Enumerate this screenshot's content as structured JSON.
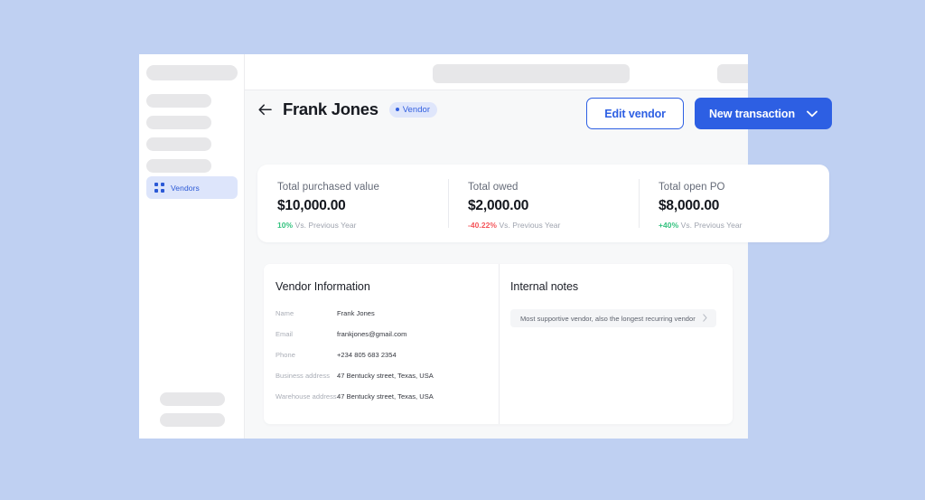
{
  "theme": {
    "background": "#bfd0f2",
    "app_surface": "#f7f8f9",
    "accent": "#2d5fe3",
    "positive": "#34c27f",
    "negative": "#f4555a"
  },
  "sidebar": {
    "active_item": {
      "label": "Vendors",
      "icon": "grid-icon"
    }
  },
  "topbar": {
    "search_placeholder": ""
  },
  "header": {
    "back_icon": "arrow-left-icon",
    "title": "Frank Jones",
    "badge": "Vendor",
    "edit_button": "Edit vendor",
    "new_transaction_button": "New transaction",
    "new_transaction_icon": "chevron-down-icon"
  },
  "stats": [
    {
      "label": "Total purchased value",
      "value": "$10,000.00",
      "delta": "10%",
      "delta_color": "#34c27f",
      "comparison": "Vs. Previous Year"
    },
    {
      "label": "Total owed",
      "value": "$2,000.00",
      "delta": "-40.22%",
      "delta_color": "#f4555a",
      "comparison": "Vs. Previous Year"
    },
    {
      "label": "Total open PO",
      "value": "$8,000.00",
      "delta": "+40%",
      "delta_color": "#34c27f",
      "comparison": "Vs. Previous Year"
    }
  ],
  "vendor_information": {
    "title": "Vendor Information",
    "rows": [
      {
        "label": "Name",
        "value": "Frank Jones"
      },
      {
        "label": "Email",
        "value": "frankjones@gmail.com"
      },
      {
        "label": "Phone",
        "value": "+234 805 683 2354"
      },
      {
        "label": "Business address",
        "value": "47 Bentucky street, Texas, USA"
      },
      {
        "label": "Warehouse address",
        "value": "47 Bentucky street, Texas, USA"
      }
    ]
  },
  "internal_notes": {
    "title": "Internal notes",
    "items": [
      {
        "text": "Most supportive vendor, also the longest recurring vendor",
        "chevron": "chevron-right-icon"
      }
    ]
  }
}
